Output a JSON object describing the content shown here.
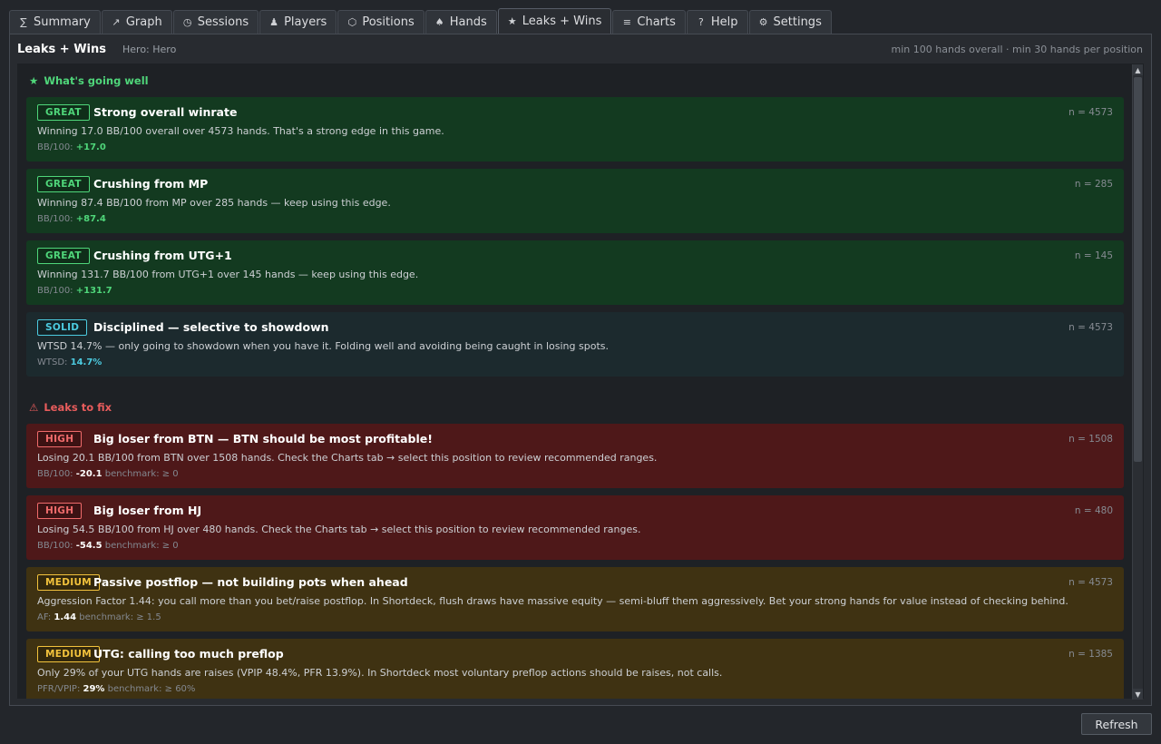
{
  "tabs": [
    {
      "icon": "∑",
      "icon_name": "sum-icon",
      "label": "Summary"
    },
    {
      "icon": "↗",
      "icon_name": "graph-icon",
      "label": "Graph"
    },
    {
      "icon": "◷",
      "icon_name": "clock-icon",
      "label": "Sessions"
    },
    {
      "icon": "♟",
      "icon_name": "player-icon",
      "label": "Players"
    },
    {
      "icon": "⬡",
      "icon_name": "hexagon-icon",
      "label": "Positions"
    },
    {
      "icon": "♠",
      "icon_name": "spade-icon",
      "label": "Hands"
    },
    {
      "icon": "★",
      "icon_name": "star-icon",
      "label": "Leaks + Wins"
    },
    {
      "icon": "≡",
      "icon_name": "list-icon",
      "label": "Charts"
    },
    {
      "icon": "?",
      "icon_name": "help-icon",
      "label": "Help"
    },
    {
      "icon": "⚙",
      "icon_name": "gear-icon",
      "label": "Settings"
    }
  ],
  "active_tab": "Leaks + Wins",
  "panel": {
    "title": "Leaks + Wins",
    "hero": "Hero: Hero",
    "note": "min 100 hands overall · min 30 hands per position"
  },
  "sections": {
    "good": {
      "icon": "★",
      "label": "What's going well"
    },
    "bad": {
      "icon": "⚠",
      "label": "Leaks to fix"
    }
  },
  "wins": [
    {
      "level": "great",
      "badge": "GREAT",
      "title": "Strong overall winrate",
      "n": "n = 4573",
      "desc": "Winning 17.0 BB/100 overall over 4573 hands. That's a strong edge in this game.",
      "metric_label": "BB/100:",
      "metric_value": "+17.0",
      "benchmark": ""
    },
    {
      "level": "great",
      "badge": "GREAT",
      "title": "Crushing from MP",
      "n": "n = 285",
      "desc": "Winning 87.4 BB/100 from MP over 285 hands — keep using this edge.",
      "metric_label": "BB/100:",
      "metric_value": "+87.4",
      "benchmark": ""
    },
    {
      "level": "great",
      "badge": "GREAT",
      "title": "Crushing from UTG+1",
      "n": "n = 145",
      "desc": "Winning 131.7 BB/100 from UTG+1 over 145 hands — keep using this edge.",
      "metric_label": "BB/100:",
      "metric_value": "+131.7",
      "benchmark": ""
    },
    {
      "level": "solid",
      "badge": "SOLID",
      "title": "Disciplined — selective to showdown",
      "n": "n = 4573",
      "desc": "WTSD 14.7% — only going to showdown when you have it. Folding well and avoiding being caught in losing spots.",
      "metric_label": "WTSD:",
      "metric_value": "14.7%",
      "benchmark": ""
    }
  ],
  "leaks": [
    {
      "level": "high",
      "badge": "HIGH",
      "title": "Big loser from BTN — BTN should be most profitable!",
      "n": "n = 1508",
      "desc": "Losing 20.1 BB/100 from BTN over 1508 hands. Check the Charts tab → select this position to review recommended ranges.",
      "metric_label": "BB/100:",
      "metric_value": "-20.1",
      "benchmark": "benchmark: ≥ 0"
    },
    {
      "level": "high",
      "badge": "HIGH",
      "title": "Big loser from HJ",
      "n": "n = 480",
      "desc": "Losing 54.5 BB/100 from HJ over 480 hands. Check the Charts tab → select this position to review recommended ranges.",
      "metric_label": "BB/100:",
      "metric_value": "-54.5",
      "benchmark": "benchmark: ≥ 0"
    },
    {
      "level": "medium",
      "badge": "MEDIUM",
      "title": "Passive postflop — not building pots when ahead",
      "n": "n = 4573",
      "desc": "Aggression Factor 1.44: you call more than you bet/raise postflop. In Shortdeck, flush draws have massive equity — semi-bluff them aggressively. Bet your strong hands for value instead of checking behind.",
      "metric_label": "AF:",
      "metric_value": "1.44",
      "benchmark": "benchmark: ≥ 1.5"
    },
    {
      "level": "medium",
      "badge": "MEDIUM",
      "title": "UTG: calling too much preflop",
      "n": "n = 1385",
      "desc": "Only 29% of your UTG hands are raises (VPIP 48.4%, PFR 13.9%). In Shortdeck most voluntary preflop actions should be raises, not calls.",
      "metric_label": "PFR/VPIP:",
      "metric_value": "29%",
      "benchmark": "benchmark: ≥ 60%"
    }
  ],
  "colors": {
    "great": "#4fd67a",
    "solid": "#4ccbe0",
    "high": "#ef6b6b",
    "medium": "#f2c23c"
  },
  "scrollbar": {
    "up": "▲",
    "down": "▼"
  },
  "refresh_label": "Refresh"
}
